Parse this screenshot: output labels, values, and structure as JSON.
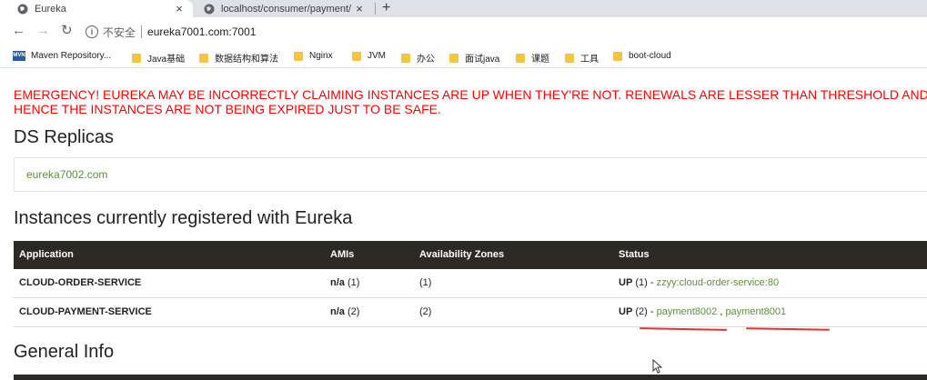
{
  "browser": {
    "tabs": [
      {
        "title": "Eureka",
        "active": true
      },
      {
        "title": "localhost/consumer/payment/",
        "active": false
      }
    ],
    "new_tab_label": "+",
    "close_glyph": "×",
    "address": {
      "security_label": "不安全",
      "url": "eureka7001.com:7001"
    },
    "bookmarks": [
      {
        "label": "Maven Repository...",
        "icon": "maven-icon"
      },
      {
        "label": "Java基础",
        "icon": "folder-icon"
      },
      {
        "label": "数据结构和算法",
        "icon": "folder-icon"
      },
      {
        "label": "Nginx",
        "icon": "folder-icon"
      },
      {
        "label": "JVM",
        "icon": "folder-icon"
      },
      {
        "label": "办公",
        "icon": "folder-icon"
      },
      {
        "label": "面试java",
        "icon": "folder-icon"
      },
      {
        "label": "课题",
        "icon": "folder-icon"
      },
      {
        "label": "工具",
        "icon": "folder-icon"
      },
      {
        "label": "boot-cloud",
        "icon": "folder-icon"
      }
    ]
  },
  "page": {
    "emergency_line1": "EMERGENCY! EUREKA MAY BE INCORRECTLY CLAIMING INSTANCES ARE UP WHEN THEY'RE NOT. RENEWALS ARE LESSER THAN THRESHOLD AND",
    "emergency_line2": "HENCE THE INSTANCES ARE NOT BEING EXPIRED JUST TO BE SAFE.",
    "ds_replicas_title": "DS Replicas",
    "replica_link": "eureka7002.com",
    "instances_title": "Instances currently registered with Eureka",
    "table": {
      "headers": [
        "Application",
        "AMIs",
        "Availability Zones",
        "Status"
      ],
      "rows": [
        {
          "application": "CLOUD-ORDER-SERVICE",
          "amis_bold": "n/a",
          "amis_count": "(1)",
          "zones": "(1)",
          "status_bold": "UP",
          "status_count": "(1) -",
          "instances": [
            "zzyy:cloud-order-service:80"
          ]
        },
        {
          "application": "CLOUD-PAYMENT-SERVICE",
          "amis_bold": "n/a",
          "amis_count": "(2)",
          "zones": "(2)",
          "status_bold": "UP",
          "status_count": "(2) -",
          "instances": [
            "payment8002",
            "payment8001"
          ],
          "separator": ","
        }
      ]
    },
    "general_info_title": "General Info"
  },
  "colors": {
    "emergency": "#ff0000",
    "link": "#5b8f3c",
    "table_header_bg": "#2d2a26",
    "annotation_underline": "#e53030"
  }
}
